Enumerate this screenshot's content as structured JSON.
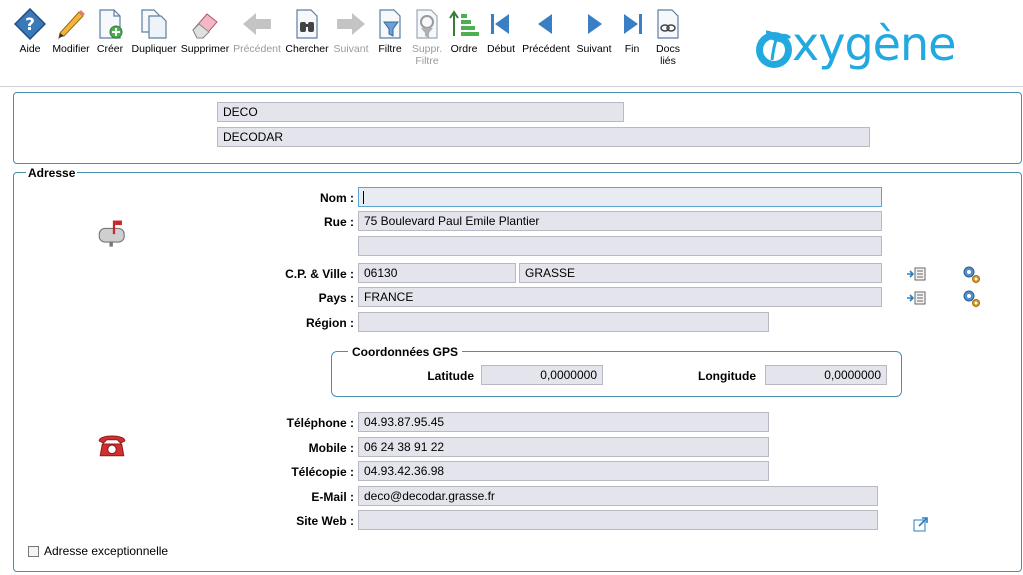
{
  "toolbar": {
    "buttons": [
      {
        "id": "aide",
        "label": "Aide",
        "icon": "help-icon",
        "enabled": true
      },
      {
        "id": "modifier",
        "label": "Modifier",
        "icon": "pencil-icon",
        "enabled": true
      },
      {
        "id": "creer",
        "label": "Créer",
        "icon": "new-document-icon",
        "enabled": true
      },
      {
        "id": "dupliquer",
        "label": "Dupliquer",
        "icon": "duplicate-icon",
        "enabled": true
      },
      {
        "id": "supprimer",
        "label": "Supprimer",
        "icon": "eraser-icon",
        "enabled": true
      },
      {
        "id": "precedent",
        "label": "Précédent",
        "icon": "arrow-left-icon",
        "enabled": false
      },
      {
        "id": "chercher",
        "label": "Chercher",
        "icon": "binoculars-icon",
        "enabled": true
      },
      {
        "id": "suivant",
        "label": "Suivant",
        "icon": "arrow-right-icon",
        "enabled": false
      },
      {
        "id": "filtre",
        "label": "Filtre",
        "icon": "filter-icon",
        "enabled": true
      },
      {
        "id": "suppr_filtre",
        "label": "Suppr.\nFiltre",
        "icon": "remove-filter-icon",
        "enabled": false
      },
      {
        "id": "ordre",
        "label": "Ordre",
        "icon": "sort-order-icon",
        "enabled": true
      },
      {
        "id": "debut",
        "label": "Début",
        "icon": "first-record-icon",
        "enabled": true
      },
      {
        "id": "precedent2",
        "label": "Précédent",
        "icon": "previous-record-icon",
        "enabled": true
      },
      {
        "id": "suivant2",
        "label": "Suivant",
        "icon": "next-record-icon",
        "enabled": true
      },
      {
        "id": "fin",
        "label": "Fin",
        "icon": "last-record-icon",
        "enabled": true
      },
      {
        "id": "docs",
        "label": "Docs\nliés",
        "icon": "linked-docs-icon",
        "enabled": true
      }
    ]
  },
  "logo": {
    "text": "xygène",
    "brand_color": "#22a9df"
  },
  "header": {
    "code": "DECO",
    "name": "DECODAR"
  },
  "adresse": {
    "legend": "Adresse",
    "nom_label": "Nom :",
    "nom": "",
    "rue_label": "Rue :",
    "rue1": "75 Boulevard Paul Emile Plantier",
    "rue2": "",
    "cp_label": "C.P. & Ville :",
    "cp": "06130",
    "ville": "GRASSE",
    "pays_label": "Pays :",
    "pays": "FRANCE",
    "region_label": "Région :",
    "region": "",
    "gps": {
      "legend": "Coordonnées GPS",
      "lat_label": "Latitude",
      "lat": "0,0000000",
      "lon_label": "Longitude",
      "lon": "0,0000000"
    },
    "tel_label": "Téléphone :",
    "tel": "04.93.87.95.45",
    "mobile_label": "Mobile :",
    "mobile": "06 24 38 91 22",
    "fax_label": "Télécopie :",
    "fax": "04.93.42.36.98",
    "email_label": "E-Mail :",
    "email": "deco@decodar.grasse.fr",
    "web_label": "Site Web :",
    "web": "",
    "exceptional_label": "Adresse exceptionnelle"
  }
}
